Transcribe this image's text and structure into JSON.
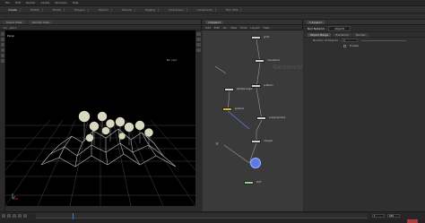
{
  "menu": [
    "File",
    "Edit",
    "Render",
    "Assets",
    "Windows",
    "Help"
  ],
  "shelf_tabs": [
    "Create",
    "Modify",
    "Model",
    "Polygon",
    "Deform",
    "Texture",
    "Rigging",
    "Characters",
    "Constraints",
    "Hair Utils"
  ],
  "viewport": {
    "tabs": [
      "Scene View",
      "Render View"
    ],
    "path": [
      "obj",
      "geo1"
    ],
    "view_label": "Persp",
    "cam_label": "No cam",
    "status": "Left mouse tumbles. Middle pans. Right dollies. Ctrl+Alt+Left box-zooms. Ctrl+Right zooms. Spacebar-Ctrl-Left tilts. Hold L for alternate tumble, dolly, and zoom."
  },
  "network": {
    "tabs": [
      "/obj/geo1"
    ],
    "menus": [
      "Add",
      "Edit",
      "Go",
      "View",
      "Tools",
      "Layout",
      "Help"
    ],
    "watermark": "Geometry",
    "nodes": [
      {
        "label": "grid1"
      },
      {
        "label": "mountain1"
      },
      {
        "label": "scatter1"
      },
      {
        "label": "attribwrangle"
      },
      {
        "label": "sphere1"
      },
      {
        "label": "copytopoints1"
      },
      {
        "label": "merge1"
      },
      {
        "label": "OUT"
      }
    ]
  },
  "parameters": {
    "tabs": [
      "/obj/geo1"
    ],
    "title": "Null Network",
    "name": "object1",
    "subtabs": [
      "Object Merge",
      "Transform",
      "Render"
    ],
    "rows": [
      {
        "label": "Number of Objects",
        "value": "1"
      },
      {
        "label": "Enable",
        "checked": true
      }
    ]
  },
  "timeline": {
    "start": "1",
    "end": "240",
    "frame": "1"
  },
  "colors": {
    "accent": "#3a7bd5",
    "node_yellow": "#e0b030",
    "node_blue": "#5a7ae8",
    "node_white": "#cfcfcf"
  }
}
